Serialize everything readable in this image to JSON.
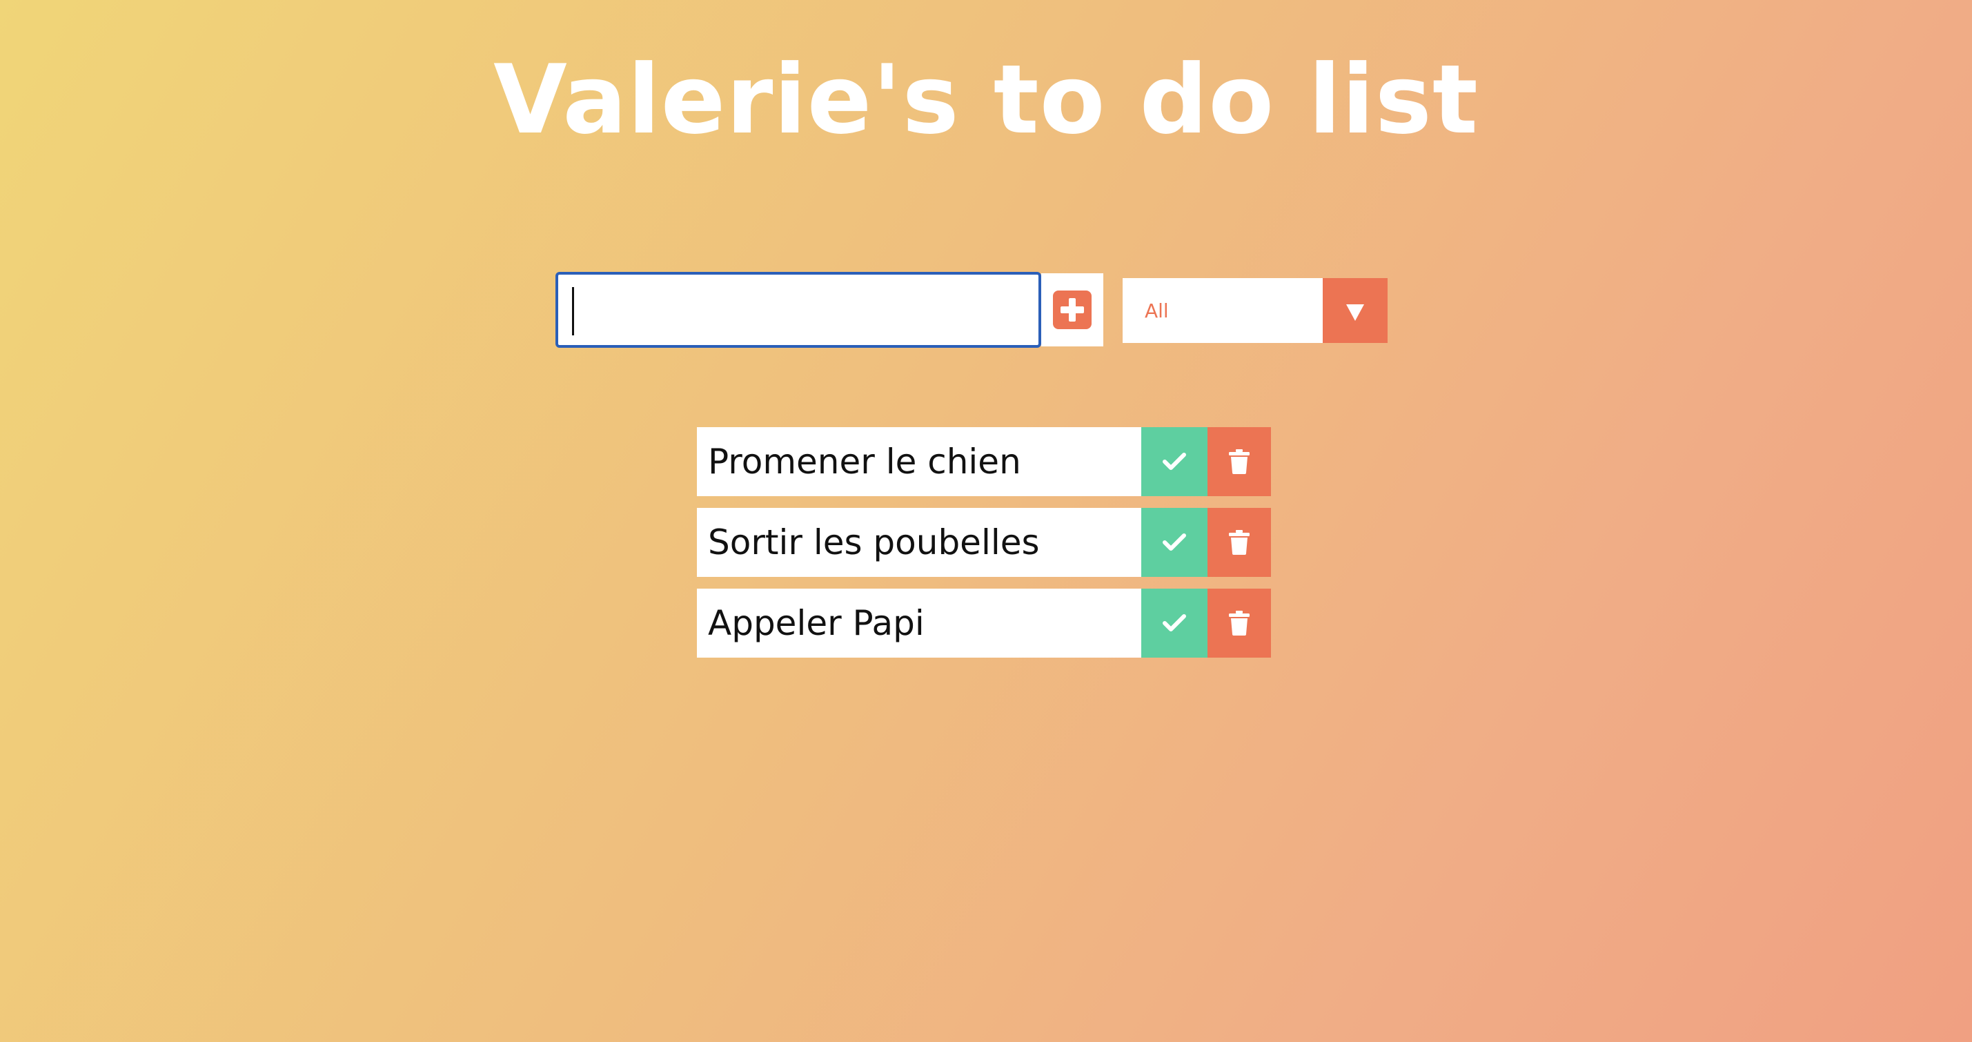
{
  "header": {
    "title": "Valerie's to do list"
  },
  "add_form": {
    "input_value": "",
    "add_icon": "plus-square-icon"
  },
  "filter": {
    "selected": "All",
    "arrow_icon": "caret-down-icon"
  },
  "todos": [
    {
      "text": "Promener le chien"
    },
    {
      "text": "Sortir les poubelles"
    },
    {
      "text": "Appeler Papi"
    }
  ],
  "colors": {
    "accent": "#ec7453",
    "complete": "#5ecfa0",
    "input_focus": "#2b5fb8"
  }
}
